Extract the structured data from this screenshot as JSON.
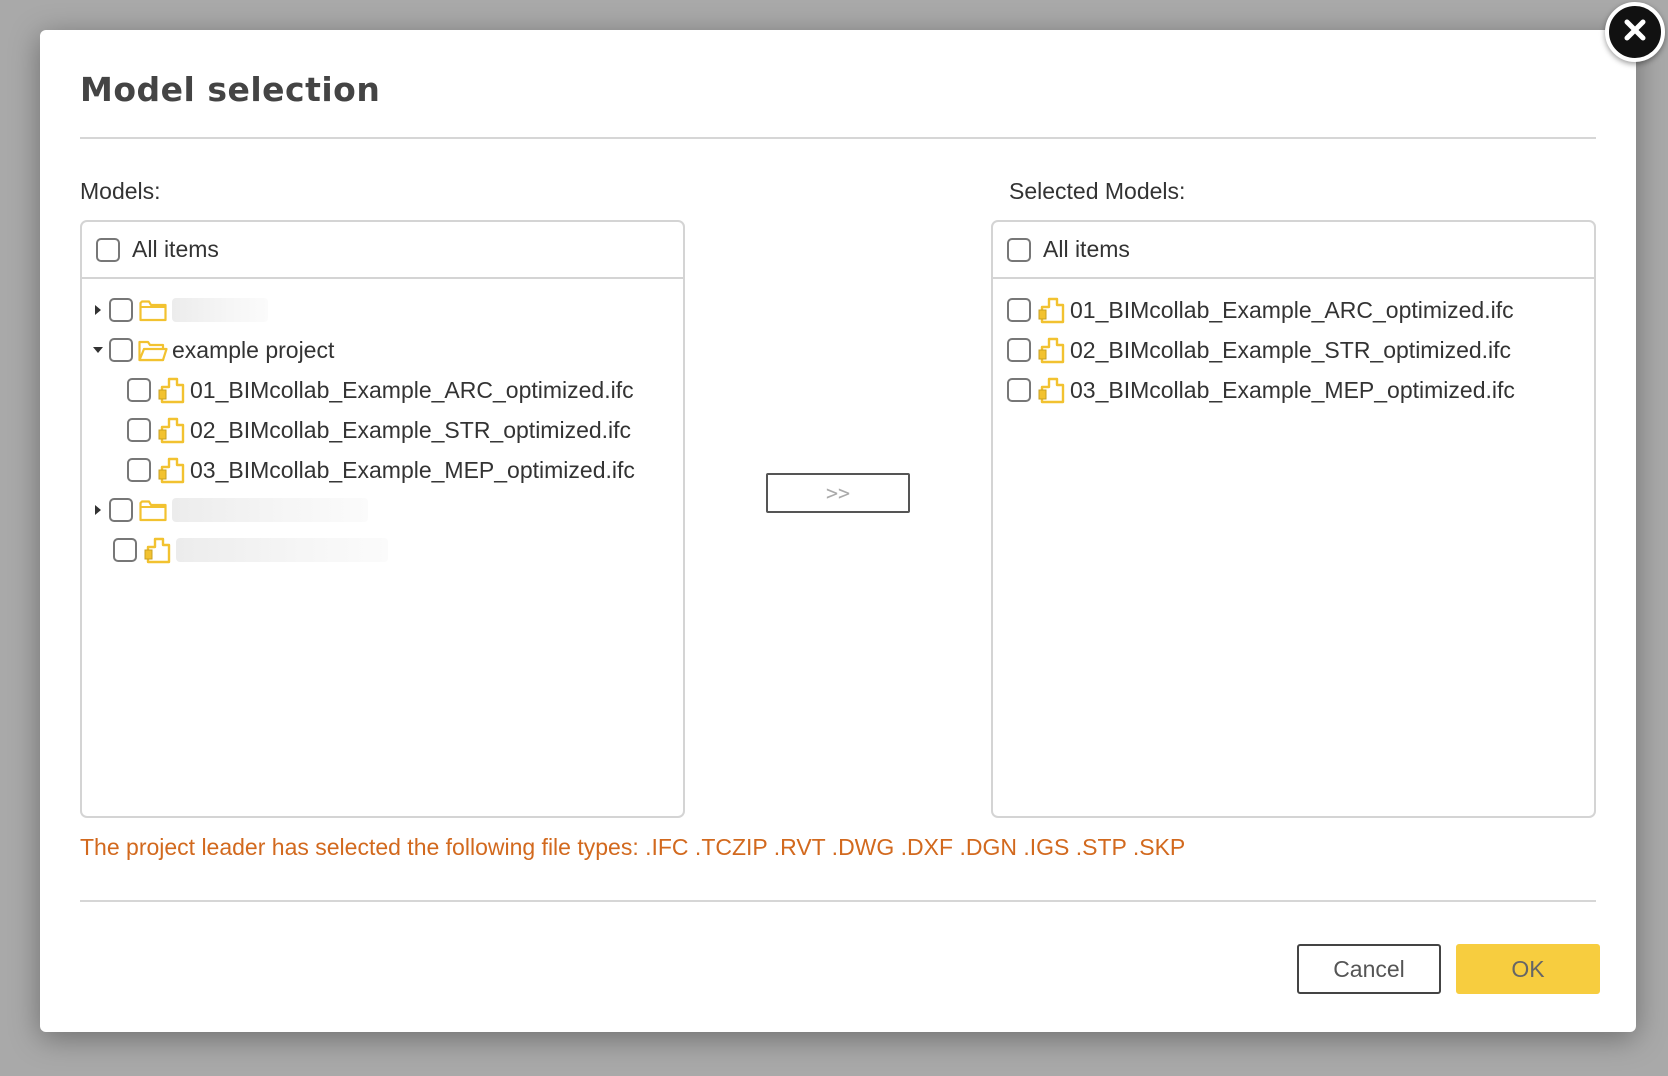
{
  "dialog": {
    "title": "Model selection",
    "close_icon": "close-icon",
    "models_label": "Models:",
    "selected_label": "Selected Models:",
    "all_items_label": "All items",
    "move_button_label": ">>",
    "file_types_notice": "The project leader has selected the following file types: .IFC .TCZIP .RVT .DWG .DXF .DGN .IGS .STP .SKP",
    "cancel_label": "Cancel",
    "ok_label": "OK"
  },
  "models_tree": [
    {
      "type": "folder",
      "label": "",
      "blurred": true,
      "expanded": false
    },
    {
      "type": "folder",
      "label": "example project",
      "blurred": false,
      "expanded": true
    },
    {
      "type": "file",
      "label": "01_BIMcollab_Example_ARC_optimized.ifc",
      "level": 1
    },
    {
      "type": "file",
      "label": "02_BIMcollab_Example_STR_optimized.ifc",
      "level": 1
    },
    {
      "type": "file",
      "label": "03_BIMcollab_Example_MEP_optimized.ifc",
      "level": 1
    },
    {
      "type": "folder",
      "label": "",
      "blurred": true,
      "expanded": false
    },
    {
      "type": "file",
      "label": "",
      "blurred": true,
      "level": 0
    }
  ],
  "selected_models": [
    {
      "label": "01_BIMcollab_Example_ARC_optimized.ifc"
    },
    {
      "label": "02_BIMcollab_Example_STR_optimized.ifc"
    },
    {
      "label": "03_BIMcollab_Example_MEP_optimized.ifc"
    }
  ],
  "colors": {
    "accent_ok": "#f7cd3f",
    "notice": "#d2691e",
    "folder": "#f2c230",
    "model": "#f2c230"
  }
}
